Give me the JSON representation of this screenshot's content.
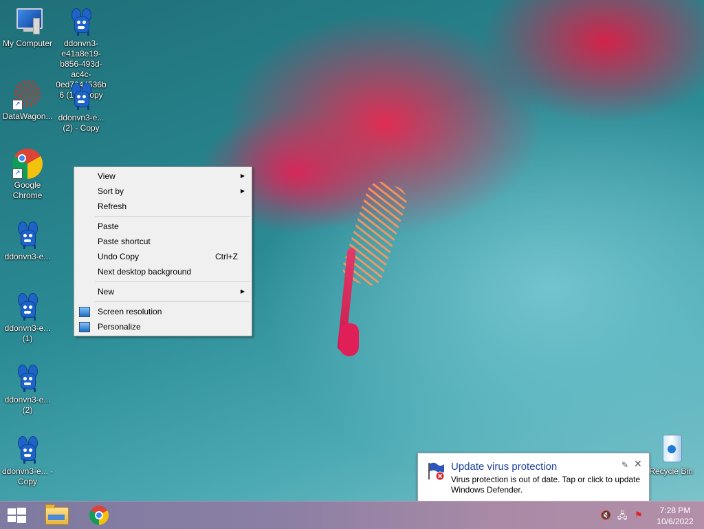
{
  "desktop_icons": {
    "my_computer": "My Computer",
    "ddonvn3_1_copy": "ddonvn3-e41a8e19-b856-493d-ac4c-0ed7044536b6 (1) - Copy",
    "datawagon": "DataWagon...",
    "ddonvn3_2_copy": "ddonvn3-e... (2) - Copy",
    "chrome": "Google Chrome",
    "ddonvn3": "ddonvn3-e...",
    "ddonvn3_1": "ddonvn3-e... (1)",
    "ddonvn3_2": "ddonvn3-e... (2)",
    "ddonvn3_copy": "ddonvn3-e... - Copy",
    "recycle_bin": "Recycle Bin"
  },
  "context_menu": {
    "view": "View",
    "sort_by": "Sort by",
    "refresh": "Refresh",
    "paste": "Paste",
    "paste_shortcut": "Paste shortcut",
    "undo_copy": "Undo Copy",
    "undo_copy_shortcut": "Ctrl+Z",
    "next_background": "Next desktop background",
    "new": "New",
    "screen_resolution": "Screen resolution",
    "personalize": "Personalize",
    "submenu_glyph": "▶"
  },
  "notification": {
    "title": "Update virus protection",
    "body": "Virus protection is out of date. Tap or click to update Windows Defender.",
    "pin_glyph": "✎",
    "close_glyph": "✕"
  },
  "taskbar": {
    "time": "7:28 PM",
    "date": "10/6/2022",
    "speaker_glyph": "🔇",
    "network_glyph": "🖧",
    "flag_glyph": "⚑"
  },
  "colors": {
    "accent": "#1c3f9c",
    "taskbar_start": "#7e7aa0",
    "taskbar_end": "#b38fa9",
    "menu_bg": "#f0f0f0"
  }
}
